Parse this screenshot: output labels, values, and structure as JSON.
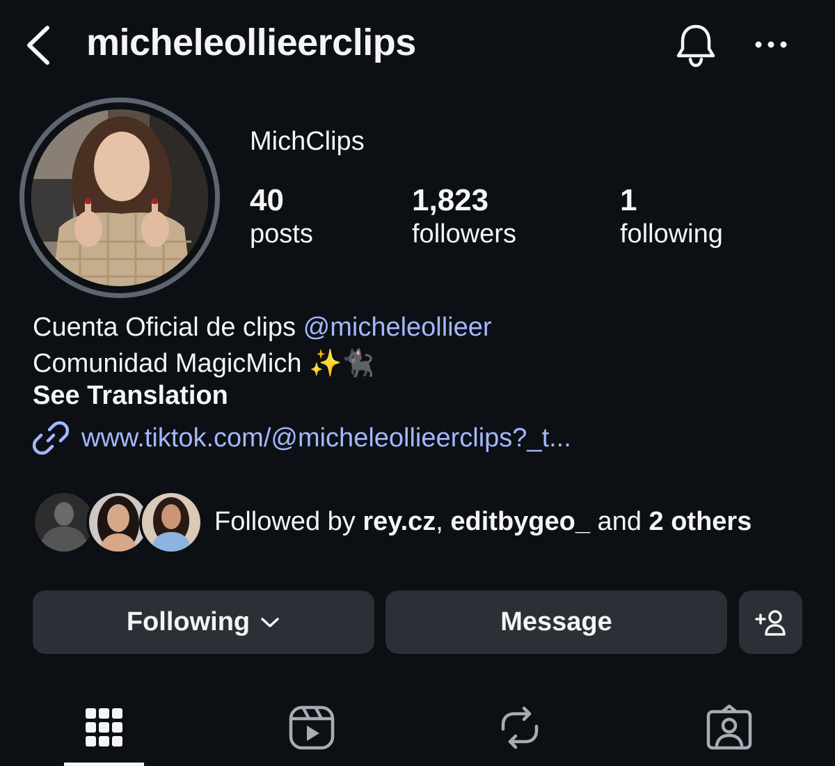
{
  "header": {
    "username": "micheleollieerclips"
  },
  "profile": {
    "display_name": "MichClips",
    "stats": [
      {
        "value": "40",
        "label": "posts"
      },
      {
        "value": "1,823",
        "label": "followers"
      },
      {
        "value": "1",
        "label": "following"
      }
    ]
  },
  "bio": {
    "line1_text": "Cuenta Oficial de clips ",
    "line1_mention": "@micheleollieer",
    "line2_text": "Comunidad MagicMich ",
    "line2_emoji": "✨🐈‍⬛",
    "see_translation": "See Translation",
    "link": "www.tiktok.com/@micheleollieerclips?_t..."
  },
  "followed_by": {
    "prefix": "Followed by ",
    "user1": "rey.cz",
    "separator": ", ",
    "user2": "editbygeo_",
    "conjunction": " and ",
    "others": "2 others"
  },
  "actions": {
    "following_label": "Following",
    "message_label": "Message"
  },
  "tabs": {
    "active": "grid",
    "items": [
      "grid-icon",
      "reels-icon",
      "reposts-icon",
      "tagged-icon"
    ]
  },
  "colors": {
    "background": "#0c1014",
    "button": "#2b2f36",
    "link": "#a4b7ff",
    "text": "#f5f5f5",
    "avatar_ring": "#5e6570"
  }
}
